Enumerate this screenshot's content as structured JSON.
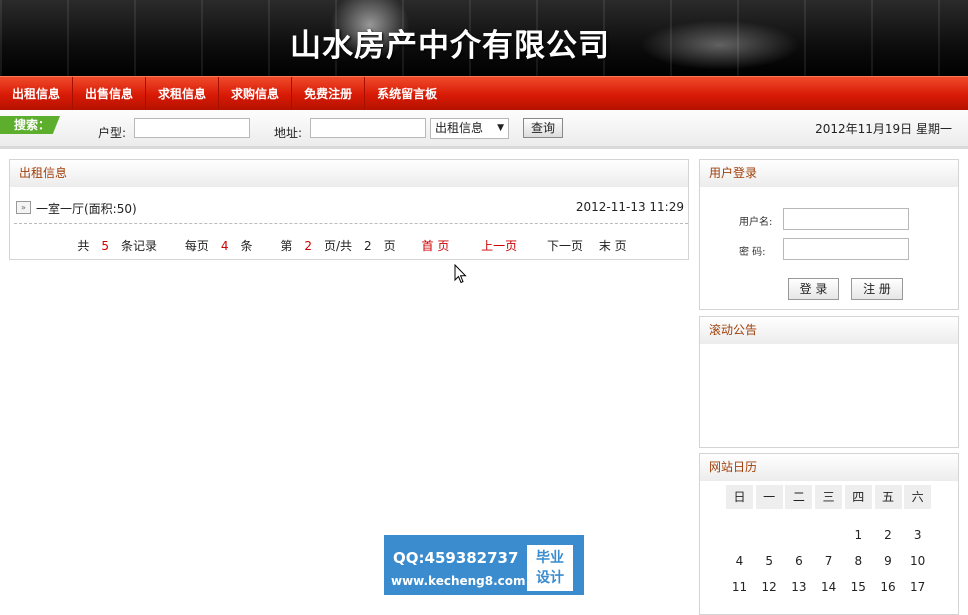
{
  "header": {
    "site_title": "山水房产中介有限公司"
  },
  "nav": {
    "items": [
      "出租信息",
      "出售信息",
      "求租信息",
      "求购信息",
      "免费注册",
      "系统留言板"
    ]
  },
  "search": {
    "tag_label": "搜索：",
    "type_label": "户型:",
    "address_label": "地址:",
    "category_selected": "出租信息",
    "query_button": "查询",
    "date_text": "2012年11月19日 星期一"
  },
  "main": {
    "title": "出租信息",
    "listings": [
      {
        "title": "一室一厅(面积:50)",
        "time": "2012-11-13 11:29"
      }
    ],
    "pager": {
      "total_prefix": "共",
      "total": "5",
      "total_suffix": "条记录",
      "per_prefix": "每页",
      "per": "4",
      "per_suffix": "条",
      "page_prefix": "第",
      "page": "2",
      "page_middle": "页/共",
      "pages": "2",
      "page_suffix": "页",
      "first": "首 页",
      "prev": "上一页",
      "next": "下一页",
      "last": "末 页"
    }
  },
  "login": {
    "title": "用户登录",
    "username_label": "用户名:",
    "password_label": "密 码:",
    "login_button": "登 录",
    "register_button": "注 册"
  },
  "notice": {
    "title": "滚动公告"
  },
  "calendar": {
    "title": "网站日历",
    "weekdays": [
      "日",
      "一",
      "二",
      "三",
      "四",
      "五",
      "六"
    ],
    "rows": [
      [
        "",
        "",
        "",
        "",
        "1",
        "2",
        "3"
      ],
      [
        "4",
        "5",
        "6",
        "7",
        "8",
        "9",
        "10"
      ],
      [
        "11",
        "12",
        "13",
        "14",
        "15",
        "16",
        "17"
      ]
    ]
  },
  "watermark": {
    "qq": "QQ:459382737",
    "url": "www.kecheng8.com",
    "badge_line1": "毕业",
    "badge_line2": "设计"
  }
}
